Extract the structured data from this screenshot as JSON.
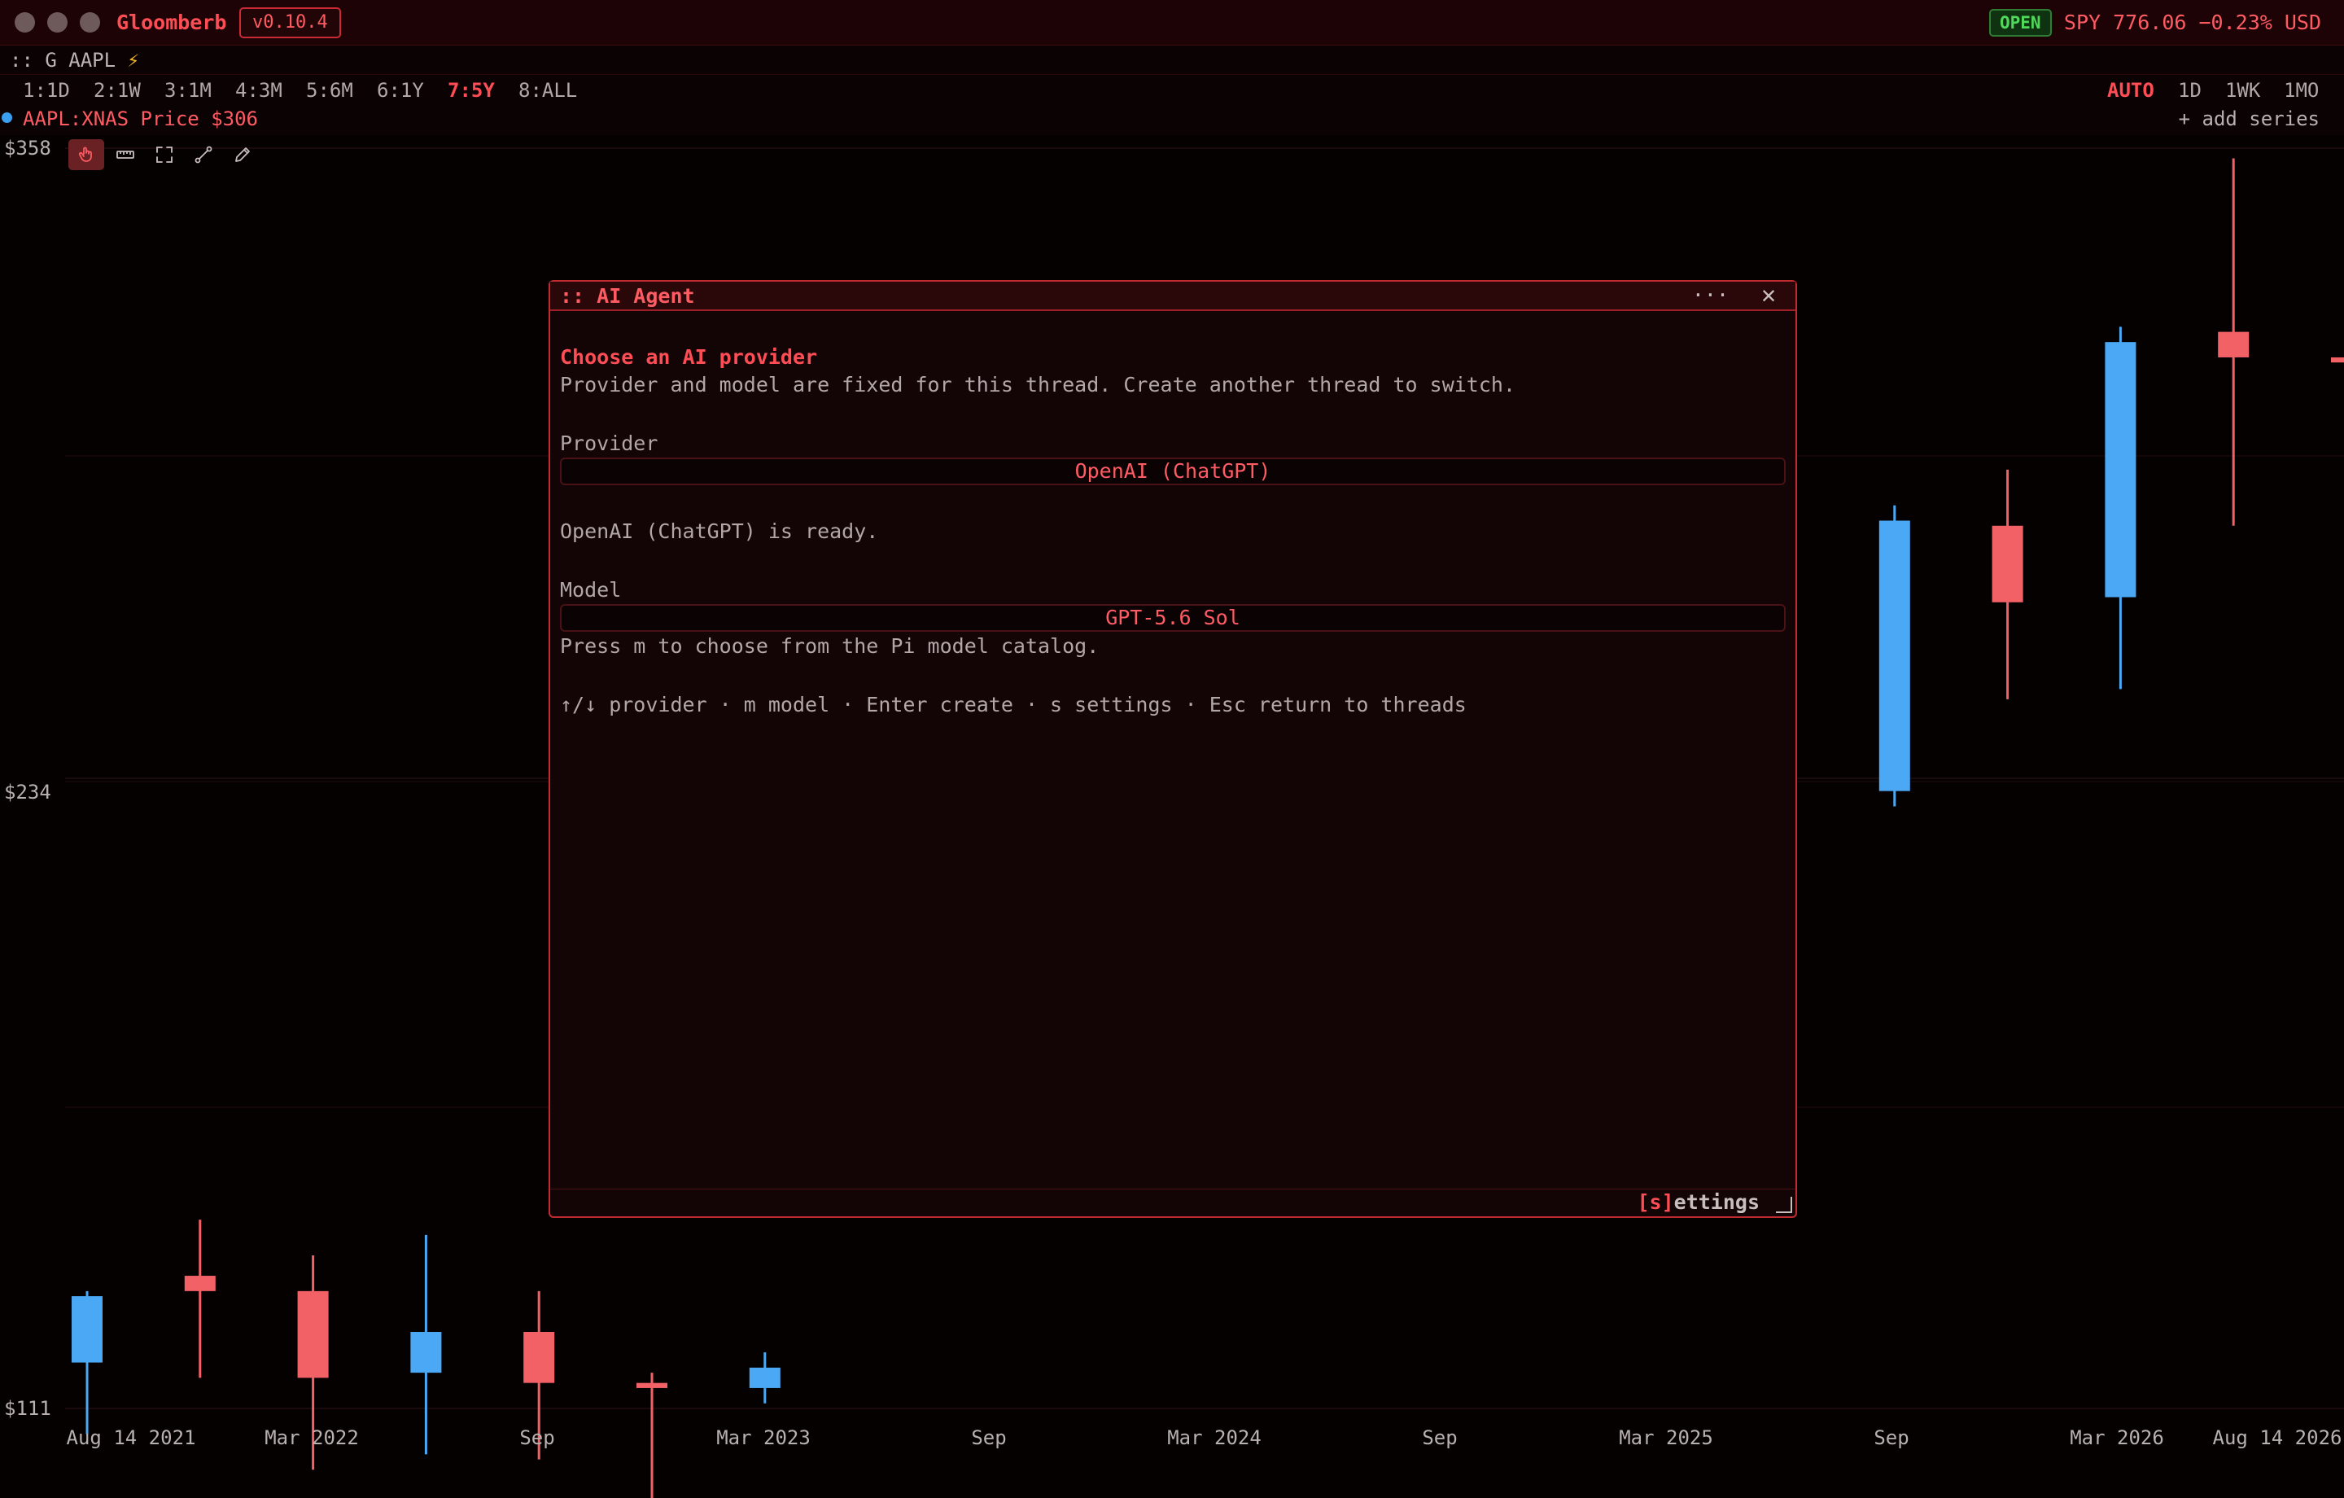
{
  "app": {
    "name": "Gloomberb",
    "version": "v0.10.4",
    "market_status": "OPEN",
    "quote": "SPY 776.06 −0.23% USD"
  },
  "command": {
    "prefix": ":: G AAPL",
    "bolt": "⚡"
  },
  "ranges": [
    "1:1D",
    "2:1W",
    "3:1M",
    "4:3M",
    "5:6M",
    "6:1Y",
    "7:5Y",
    "8:ALL"
  ],
  "active_range": "7:5Y",
  "intervals": [
    "AUTO",
    "1D",
    "1WK",
    "1MO"
  ],
  "active_interval": "AUTO",
  "series": {
    "label": "AAPL:XNAS Price $306",
    "color": "#3b9ff0",
    "add_label": "+ add series"
  },
  "tools": [
    "pointer-icon",
    "ruler-icon",
    "expand-icon",
    "trendline-icon",
    "pencil-icon"
  ],
  "colors": {
    "accent": "#ff4d55",
    "up": "#4aa8f4",
    "down": "#f26166",
    "open_badge": "#4fd85a"
  },
  "chart_data": {
    "type": "candlestick",
    "y_axis_labels": [
      "$358",
      "$234",
      "$111"
    ],
    "ylim": [
      111,
      358
    ],
    "x_axis_labels": [
      "Aug 14 2021",
      "Mar 2022",
      "Sep",
      "Mar 2023",
      "Sep",
      "Mar 2024",
      "Sep",
      "Mar 2025",
      "Sep",
      "Mar 2026",
      "Aug 14 2026"
    ],
    "grid": true,
    "candles": [
      {
        "i": 0,
        "open": 120,
        "close": 133,
        "high": 134,
        "low": 106,
        "dir": "up"
      },
      {
        "i": 1,
        "open": 137,
        "close": 134,
        "high": 148,
        "low": 117,
        "dir": "down"
      },
      {
        "i": 2,
        "open": 134,
        "close": 117,
        "high": 141,
        "low": 99,
        "dir": "down"
      },
      {
        "i": 3,
        "open": 118,
        "close": 126,
        "high": 145,
        "low": 102,
        "dir": "up"
      },
      {
        "i": 4,
        "open": 126,
        "close": 116,
        "high": 134,
        "low": 101,
        "dir": "down"
      },
      {
        "i": 5,
        "open": 116,
        "close": 115,
        "high": 118,
        "low": 92,
        "dir": "down"
      },
      {
        "i": 6,
        "open": 115,
        "close": 119,
        "high": 122,
        "low": 112,
        "dir": "up"
      },
      {
        "i": 16,
        "open": 232,
        "close": 285,
        "high": 288,
        "low": 229,
        "dir": "up"
      },
      {
        "i": 17,
        "open": 284,
        "close": 269,
        "high": 295,
        "low": 250,
        "dir": "down"
      },
      {
        "i": 18,
        "open": 270,
        "close": 320,
        "high": 323,
        "low": 252,
        "dir": "up"
      },
      {
        "i": 19,
        "open": 322,
        "close": 317,
        "high": 356,
        "low": 284,
        "dir": "down"
      },
      {
        "i": 20,
        "open": 317,
        "close": 316,
        "high": 318,
        "low": 315,
        "dir": "down"
      }
    ]
  },
  "agent": {
    "title": ":: AI Agent",
    "more": "···",
    "close": "✕",
    "heading": "Choose an AI provider",
    "description": "Provider and model are fixed for this thread. Create another thread to switch.",
    "provider_label": "Provider",
    "provider_value": "OpenAI (ChatGPT)",
    "status": "OpenAI (ChatGPT) is ready.",
    "model_label": "Model",
    "model_value": "GPT-5.6 Sol",
    "model_hint": "Press m to choose from the Pi model catalog.",
    "shortcuts": "↑/↓ provider · m model · Enter create · s settings · Esc return to threads",
    "footer_key": "[s]",
    "footer_rest": "ettings"
  }
}
